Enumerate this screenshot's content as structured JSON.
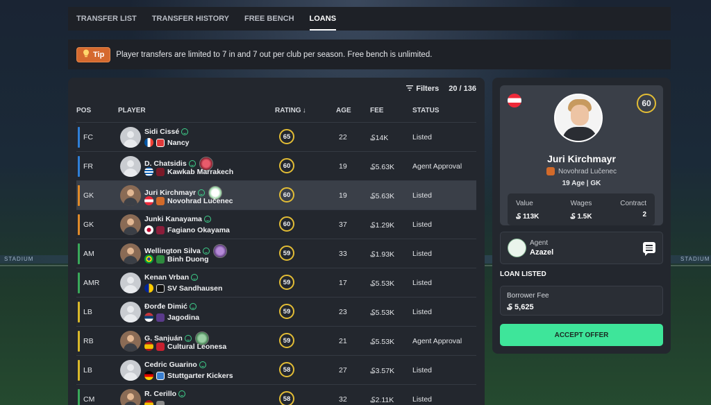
{
  "tabs": [
    {
      "label": "TRANSFER LIST",
      "active": false
    },
    {
      "label": "TRANSFER HISTORY",
      "active": false
    },
    {
      "label": "FREE BENCH",
      "active": false
    },
    {
      "label": "LOANS",
      "active": true
    }
  ],
  "tip": {
    "badge": "Tip",
    "text": "Player transfers are limited to 7 in and 7 out per club per season. Free bench is unlimited."
  },
  "toolbar": {
    "filters_label": "Filters",
    "count": "20 / 136"
  },
  "table": {
    "headers": {
      "pos": "POS",
      "player": "PLAYER",
      "rating": "RATING",
      "age": "AGE",
      "fee": "FEE",
      "status": "STATUS"
    },
    "rows": [
      {
        "pos": "FC",
        "name": "Sidi Cissé",
        "club": "Nancy",
        "rating": "65",
        "age": "22",
        "fee": "₷14K",
        "status": "Listed"
      },
      {
        "pos": "FR",
        "name": "D. Chatsidis",
        "club": "Kawkab Marrakech",
        "rating": "60",
        "age": "19",
        "fee": "₷5.63K",
        "status": "Agent Approval"
      },
      {
        "pos": "GK",
        "name": "Juri Kirchmayr",
        "club": "Novohrad Lučenec",
        "rating": "60",
        "age": "19",
        "fee": "₷5.63K",
        "status": "Listed"
      },
      {
        "pos": "GK",
        "name": "Junki Kanayama",
        "club": "Fagiano Okayama",
        "rating": "60",
        "age": "37",
        "fee": "₷1.29K",
        "status": "Listed"
      },
      {
        "pos": "AM",
        "name": "Wellington Silva",
        "club": "Binh Duong",
        "rating": "59",
        "age": "33",
        "fee": "₷1.93K",
        "status": "Listed"
      },
      {
        "pos": "AMR",
        "name": "Kenan Vrban",
        "club": "SV Sandhausen",
        "rating": "59",
        "age": "17",
        "fee": "₷5.53K",
        "status": "Listed"
      },
      {
        "pos": "LB",
        "name": "Đorđe Dimić",
        "club": "Jagodina",
        "rating": "59",
        "age": "23",
        "fee": "₷5.53K",
        "status": "Listed"
      },
      {
        "pos": "RB",
        "name": "G. Sanjuán",
        "club": "Cultural Leonesa",
        "rating": "59",
        "age": "21",
        "fee": "₷5.53K",
        "status": "Agent Approval"
      },
      {
        "pos": "LB",
        "name": "Cedric Guarino",
        "club": "Stuttgarter Kickers",
        "rating": "58",
        "age": "27",
        "fee": "₷3.57K",
        "status": "Listed"
      },
      {
        "pos": "CM",
        "name": "R. Cerillo",
        "club": "",
        "rating": "58",
        "age": "32",
        "fee": "₷2.11K",
        "status": "Listed"
      }
    ]
  },
  "detail": {
    "rating": "60",
    "name": "Juri Kirchmayr",
    "club": "Novohrad Lučenec",
    "age_pos": "19 Age | GK",
    "stats": {
      "value_label": "Value",
      "value": "₷ 113K",
      "wages_label": "Wages",
      "wages": "₷ 1.5K",
      "contract_label": "Contract",
      "contract": "2"
    },
    "agent": {
      "label": "Agent",
      "name": "Azazel"
    },
    "loan_title": "LOAN LISTED",
    "borrower_fee_label": "Borrower Fee",
    "borrower_fee": "₷ 5,625",
    "accept_label": "ACCEPT OFFER"
  },
  "colors": {
    "accent_green": "#3ee59a",
    "rating_ring": "#e3bd35",
    "tip_badge": "#d5692e",
    "pos_blue": "#2f7fd6",
    "pos_orange": "#e08a2a",
    "pos_green": "#3aa85a",
    "pos_yellow": "#d9b82a"
  },
  "stadium_signage": "STADIUM"
}
